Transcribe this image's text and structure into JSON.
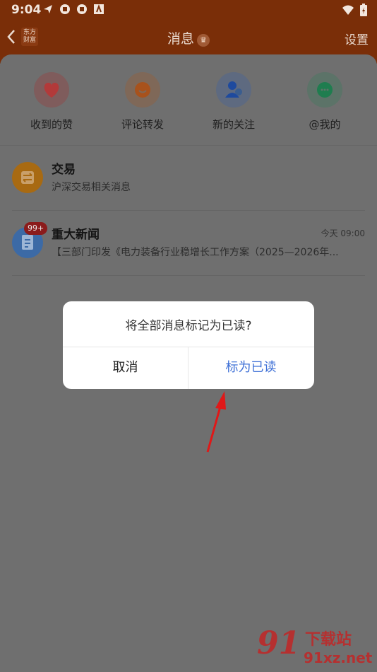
{
  "status_bar": {
    "time": "9:04"
  },
  "header": {
    "logo_text": "东方财富",
    "title": "消息",
    "settings_label": "设置"
  },
  "quick_actions": [
    {
      "label": "收到的赞",
      "icon": "heart-icon",
      "bg": "#7f5c5c",
      "fg": "#b23a3a"
    },
    {
      "label": "评论转发",
      "icon": "comment-icon",
      "bg": "#7f6858",
      "fg": "#a8521c"
    },
    {
      "label": "新的关注",
      "icon": "user-icon",
      "bg": "#5e6a80",
      "fg": "#1e4a9e"
    },
    {
      "label": "@我的",
      "icon": "chat-icon",
      "bg": "#5c7368",
      "fg": "#1f7d4f"
    }
  ],
  "messages": [
    {
      "title": "交易",
      "subtitle": "沪深交易相关消息",
      "time": "",
      "badge": "",
      "icon": "exchange-icon",
      "color": "#a86a12"
    },
    {
      "title": "重大新闻",
      "subtitle": "【三部门印发《电力装备行业稳增长工作方案（2025—2026年...",
      "time": "今天 09:00",
      "badge": "99+",
      "icon": "document-icon",
      "color": "#3c6aa6"
    }
  ],
  "dialog": {
    "message": "将全部消息标记为已读?",
    "cancel_label": "取消",
    "confirm_label": "标为已读"
  },
  "watermark": {
    "brand": "91",
    "cn": "下载站",
    "url": "91xz.net"
  }
}
